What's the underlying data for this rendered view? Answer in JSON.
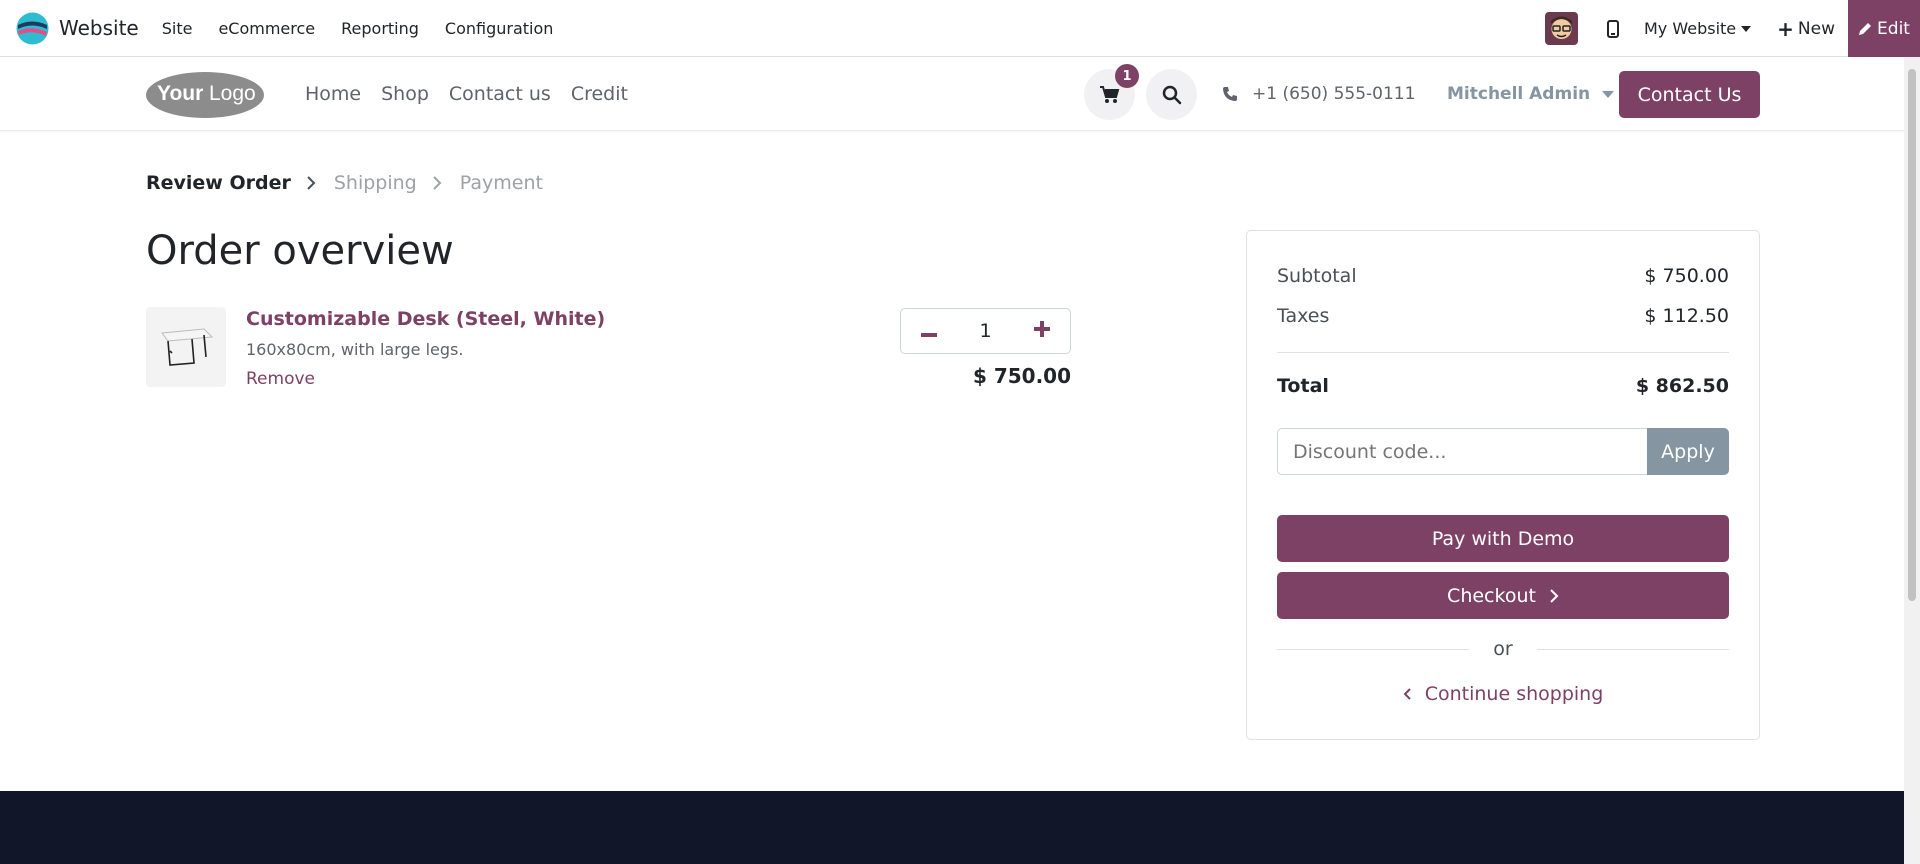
{
  "odoo_nav": {
    "app_name": "Website",
    "menu": [
      "Site",
      "eCommerce",
      "Reporting",
      "Configuration"
    ],
    "site_selector": "My Website",
    "new_label": "New",
    "edit_label": "Edit"
  },
  "site_header": {
    "logo_text": "YourLogo",
    "nav": [
      "Home",
      "Shop",
      "Contact us",
      "Credit"
    ],
    "cart_count": "1",
    "phone": "+1 (650) 555-0111",
    "user": "Mitchell Admin",
    "contact_button": "Contact Us"
  },
  "checkout": {
    "steps": [
      "Review Order",
      "Shipping",
      "Payment"
    ],
    "title": "Order overview",
    "line": {
      "name": "Customizable Desk (Steel, White)",
      "description": "160x80cm, with large legs.",
      "remove_label": "Remove",
      "quantity": "1",
      "price": "$ 750.00"
    },
    "summary": {
      "subtotal_label": "Subtotal",
      "subtotal": "$ 750.00",
      "taxes_label": "Taxes",
      "taxes": "$ 112.50",
      "total_label": "Total",
      "total": "$ 862.50",
      "discount_placeholder": "Discount code...",
      "apply_label": "Apply",
      "pay_demo_label": "Pay with Demo",
      "checkout_label": "Checkout",
      "or_label": "or",
      "continue_label": "Continue shopping"
    }
  },
  "colors": {
    "brand": "#7e4166",
    "footer": "#111629",
    "muted_button": "#8595a2"
  }
}
